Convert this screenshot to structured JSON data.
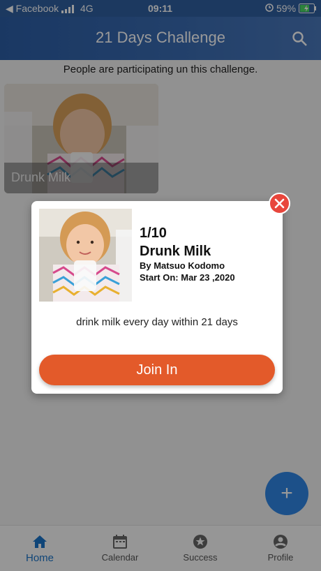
{
  "status_bar": {
    "carrier": "◀ Facebook",
    "network": "4G",
    "time": "09:11",
    "battery": "59%"
  },
  "header": {
    "title": "21 Days Challenge",
    "search_icon": "search-icon"
  },
  "subtitle": "People are participating un this challenge.",
  "card": {
    "label": "Drunk Milk"
  },
  "dialog": {
    "count": "1/10",
    "name": "Drunk Milk",
    "by": "By Matsuo Kodomo",
    "start_label": "Start On:",
    "start_date": "Mar 23 ,2020",
    "description": "drink milk every day within 21 days",
    "join_label": "Join In",
    "close_icon": "close-icon"
  },
  "fab": {
    "label": "+"
  },
  "nav": [
    {
      "label": "Home",
      "icon": "home-icon"
    },
    {
      "label": "Calendar",
      "icon": "calendar-icon"
    },
    {
      "label": "Success",
      "icon": "star-icon"
    },
    {
      "label": "Profile",
      "icon": "profile-icon"
    }
  ],
  "colors": {
    "header": "#2c5ea6",
    "accent": "#e35a2a",
    "close": "#e8463c",
    "fab": "#2f86e4",
    "active_nav": "#1a73c8"
  }
}
